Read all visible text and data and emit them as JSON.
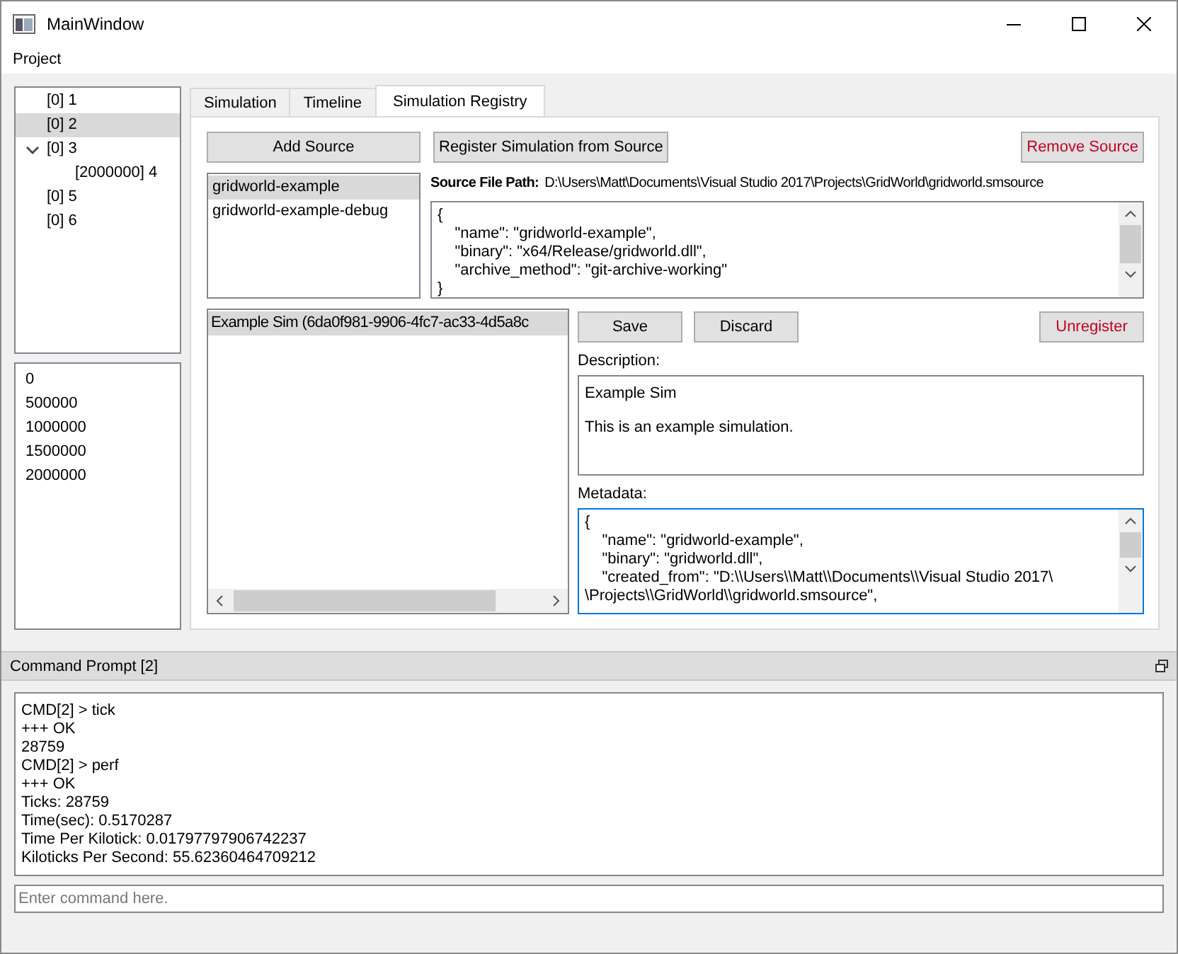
{
  "window": {
    "title": "MainWindow"
  },
  "menu_bar": [
    "Project"
  ],
  "tree": [
    {
      "label": "[0] 1",
      "selected": false
    },
    {
      "label": "[0] 2",
      "selected": true
    },
    {
      "label": "[0] 3",
      "selected": false,
      "expanded": true,
      "children": [
        {
          "label": "[2000000] 4",
          "selected": false
        }
      ]
    },
    {
      "label": "[0] 5",
      "selected": false
    },
    {
      "label": "[0] 6",
      "selected": false
    }
  ],
  "tick_list": [
    {
      "label": "0",
      "selected": false
    },
    {
      "label": "500000",
      "selected": false
    },
    {
      "label": "1000000",
      "selected": false
    },
    {
      "label": "1500000",
      "selected": false
    },
    {
      "label": "2000000",
      "selected": false
    }
  ],
  "tabs": [
    {
      "label": "Simulation",
      "selected": false
    },
    {
      "label": "Timeline",
      "selected": false
    },
    {
      "label": "Simulation Registry",
      "selected": true
    }
  ],
  "registry": {
    "toolbar": [
      {
        "label": "Add Source",
        "kind": "normal"
      },
      {
        "label": "Register Simulation from Source",
        "kind": "normal"
      },
      {
        "label": "Remove Source",
        "kind": "danger"
      }
    ],
    "sources": [
      {
        "label": "gridworld-example",
        "selected": true
      },
      {
        "label": "gridworld-example-debug",
        "selected": false
      }
    ],
    "source_path": {
      "label": "Source File Path:",
      "value": "D:\\Users\\Matt\\Documents\\Visual Studio 2017\\Projects\\GridWorld\\gridworld.smsource"
    },
    "source_json": [
      "{",
      "    \"name\": \"gridworld-example\",",
      "    \"binary\": \"x64/Release/gridworld.dll\",",
      "    \"archive_method\": \"git-archive-working\"",
      "}"
    ],
    "simulations": [
      {
        "label": "Example Sim (6da0f981-9906-4fc7-ac33-4d5a8c",
        "selected": true
      }
    ],
    "sim_buttons": [
      {
        "label": "Save",
        "kind": "normal"
      },
      {
        "label": "Discard",
        "kind": "normal"
      },
      {
        "label": "Unregister",
        "kind": "danger"
      }
    ],
    "description": {
      "label": "Description:",
      "paragraphs": [
        "Example Sim",
        "This is an example simulation."
      ]
    },
    "metadata": {
      "label": "Metadata:",
      "focused": true,
      "lines": [
        "{",
        "    \"name\": \"gridworld-example\",",
        "    \"binary\": \"gridworld.dll\",",
        "    \"created_from\": \"D:\\\\Users\\\\Matt\\\\Documents\\\\Visual Studio 2017\\",
        "\\Projects\\\\GridWorld\\\\gridworld.smsource\","
      ]
    }
  },
  "command_prompt": {
    "title": "Command Prompt [2]",
    "output": [
      "CMD[2] > tick",
      "+++ OK",
      "28759",
      "CMD[2] > perf",
      "+++ OK",
      "Ticks: 28759",
      "Time(sec): 0.5170287",
      "Time Per Kilotick: 0.01797797906742237",
      "Kiloticks Per Second: 55.62360464709212"
    ],
    "input": {
      "placeholder": "Enter command here."
    }
  }
}
